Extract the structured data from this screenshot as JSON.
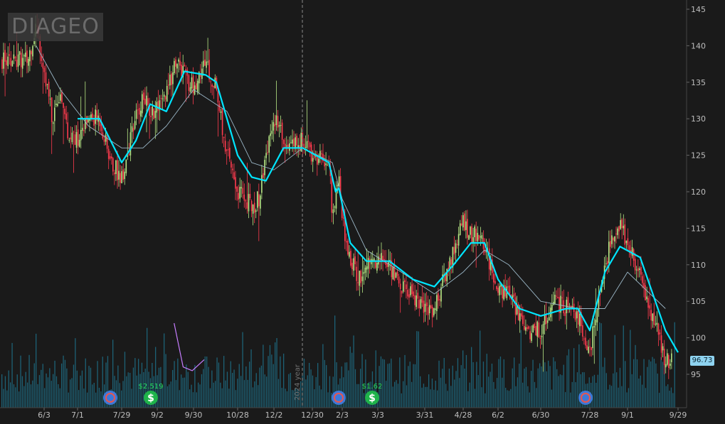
{
  "symbol_watermark": "DIAGEO",
  "year_marker_label": "2024 year",
  "last_price_label": "96.73",
  "colors": {
    "background": "#1a1a1a",
    "up_candle": "#b8e986",
    "down_candle": "#ff3b4e",
    "volume": "#1f6f86",
    "ma_fast": "#c77dff",
    "ma_mid": "#00e5ff",
    "ma_slow": "#9bb7c7",
    "badge": "#8fd3f0"
  },
  "chart_data": {
    "type": "candlestick",
    "y_axis": {
      "side": "right",
      "ticks": [
        95,
        100,
        105,
        110,
        115,
        120,
        125,
        130,
        135,
        140,
        145
      ],
      "range": [
        90,
        146
      ]
    },
    "x_axis": {
      "tick_labels": [
        "6/3",
        "7/1",
        "7/29",
        "9/2",
        "9/30",
        "10/28",
        "12/2",
        "12/30",
        "2/3",
        "3/3",
        "3/31",
        "4/28",
        "6/2",
        "6/30",
        "7/28",
        "9/1",
        "9/29"
      ]
    },
    "grid": false,
    "year_marker": {
      "between": [
        "12/2",
        "12/30"
      ]
    },
    "price_path": [
      [
        "5/20",
        138
      ],
      [
        "5/27",
        143
      ],
      [
        "6/3",
        137
      ],
      [
        "6/10",
        130
      ],
      [
        "6/17",
        134
      ],
      [
        "6/24",
        128
      ],
      [
        "7/1",
        127
      ],
      [
        "7/8",
        130
      ],
      [
        "7/15",
        130
      ],
      [
        "7/22",
        124
      ],
      [
        "7/29",
        122
      ],
      [
        "8/5",
        126
      ],
      [
        "8/12",
        130
      ],
      [
        "8/19",
        133
      ],
      [
        "8/26",
        131
      ],
      [
        "9/2",
        131
      ],
      [
        "9/9",
        133
      ],
      [
        "9/16",
        138
      ],
      [
        "9/23",
        136
      ],
      [
        "9/30",
        134
      ],
      [
        "10/7",
        138
      ],
      [
        "10/14",
        134
      ],
      [
        "10/21",
        125
      ],
      [
        "10/28",
        120
      ],
      [
        "11/4",
        119
      ],
      [
        "11/11",
        118
      ],
      [
        "11/18",
        119
      ],
      [
        "11/25",
        125
      ],
      [
        "12/2",
        130
      ],
      [
        "12/9",
        127
      ],
      [
        "12/16",
        126
      ],
      [
        "12/23",
        127
      ],
      [
        "12/30",
        125
      ],
      [
        "1/6",
        124
      ],
      [
        "1/13",
        117
      ],
      [
        "1/20",
        119
      ],
      [
        "1/27",
        122
      ],
      [
        "2/3",
        116
      ],
      [
        "2/10",
        111
      ],
      [
        "2/17",
        108
      ],
      [
        "2/24",
        110
      ],
      [
        "3/3",
        111
      ],
      [
        "3/10",
        110
      ],
      [
        "3/17",
        107
      ],
      [
        "3/24",
        106
      ],
      [
        "3/31",
        104
      ],
      [
        "4/7",
        104
      ],
      [
        "4/14",
        108
      ],
      [
        "4/21",
        112
      ],
      [
        "4/28",
        116
      ],
      [
        "5/5",
        114
      ],
      [
        "5/12",
        114
      ],
      [
        "5/19",
        113
      ],
      [
        "5/26",
        109
      ],
      [
        "6/2",
        107
      ],
      [
        "6/9",
        106
      ],
      [
        "6/16",
        103
      ],
      [
        "6/23",
        101
      ],
      [
        "6/30",
        101
      ],
      [
        "7/7",
        105
      ],
      [
        "7/14",
        104
      ],
      [
        "7/21",
        103
      ],
      [
        "7/28",
        98
      ],
      [
        "8/4",
        105
      ],
      [
        "8/11",
        110
      ],
      [
        "8/18",
        114
      ],
      [
        "8/25",
        116
      ],
      [
        "9/1",
        113
      ],
      [
        "9/8",
        108
      ],
      [
        "9/15",
        103
      ],
      [
        "9/22",
        97
      ],
      [
        "9/29",
        96.73
      ]
    ],
    "ma_slow": [
      [
        "5/27",
        140
      ],
      [
        "6/17",
        134
      ],
      [
        "7/8",
        129
      ],
      [
        "7/29",
        126
      ],
      [
        "8/19",
        126
      ],
      [
        "9/9",
        129
      ],
      [
        "9/30",
        134
      ],
      [
        "10/21",
        131
      ],
      [
        "11/11",
        124
      ],
      [
        "12/2",
        123
      ],
      [
        "12/23",
        126
      ],
      [
        "1/13",
        124
      ],
      [
        "2/3",
        119
      ],
      [
        "2/24",
        112
      ],
      [
        "3/17",
        109
      ],
      [
        "4/7",
        106
      ],
      [
        "4/28",
        109
      ],
      [
        "5/19",
        112
      ],
      [
        "6/9",
        110
      ],
      [
        "6/30",
        105
      ],
      [
        "7/21",
        104
      ],
      [
        "8/11",
        104
      ],
      [
        "9/1",
        109
      ],
      [
        "9/22",
        104
      ]
    ],
    "ma_mid": [
      [
        "7/1",
        130
      ],
      [
        "7/15",
        130
      ],
      [
        "7/29",
        124
      ],
      [
        "8/12",
        127
      ],
      [
        "8/26",
        132
      ],
      [
        "9/9",
        131
      ],
      [
        "9/23",
        136.5
      ],
      [
        "10/7",
        136
      ],
      [
        "10/14",
        135
      ],
      [
        "10/28",
        125
      ],
      [
        "11/11",
        122
      ],
      [
        "11/25",
        121.5
      ],
      [
        "12/9",
        126
      ],
      [
        "12/23",
        126
      ],
      [
        "1/6",
        124
      ],
      [
        "1/20",
        120
      ],
      [
        "1/27",
        120.5
      ],
      [
        "2/10",
        113
      ],
      [
        "2/24",
        110.5
      ],
      [
        "3/10",
        110.5
      ],
      [
        "3/24",
        108
      ],
      [
        "4/7",
        107
      ],
      [
        "4/21",
        110
      ],
      [
        "5/5",
        113
      ],
      [
        "5/19",
        113
      ],
      [
        "6/2",
        108
      ],
      [
        "6/16",
        104
      ],
      [
        "6/30",
        103
      ],
      [
        "7/14",
        104
      ],
      [
        "7/21",
        104
      ],
      [
        "7/28",
        101
      ],
      [
        "8/11",
        109
      ],
      [
        "8/25",
        112.5
      ],
      [
        "9/8",
        111
      ],
      [
        "9/22",
        101
      ],
      [
        "9/29",
        98
      ]
    ],
    "ma_fast": [
      [
        "9/15",
        102
      ],
      [
        "9/22",
        96
      ],
      [
        "9/29",
        95.5
      ],
      [
        "10/6",
        97
      ]
    ],
    "events": [
      {
        "date": "7/29",
        "type": "earnings"
      },
      {
        "date": "9/2",
        "type": "dividend",
        "label": "$2.519"
      },
      {
        "date": "2/3",
        "type": "earnings"
      },
      {
        "date": "3/3",
        "type": "dividend",
        "label": "$1.62"
      },
      {
        "date": "7/28",
        "type": "earnings"
      }
    ]
  }
}
